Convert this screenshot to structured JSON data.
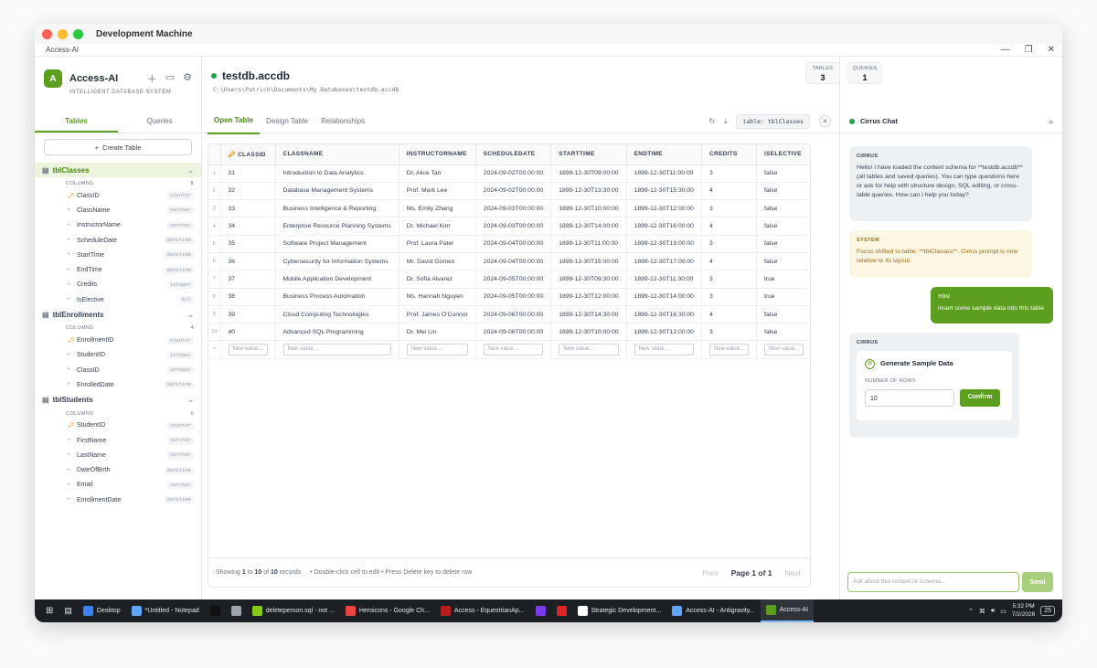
{
  "window": {
    "mac_title": "Development Machine",
    "app_title": "Access-AI"
  },
  "brand": {
    "logo_letter": "A",
    "name": "Access-AI",
    "subtitle": "INTELLIGENT DATABASE SYSTEM"
  },
  "sidebar": {
    "tabs": [
      "Tables",
      "Queries"
    ],
    "create_label": "Create Table",
    "columns_label": "COLUMNS",
    "tables": [
      {
        "name": "tblClasses",
        "count": "8",
        "columns": [
          {
            "name": "ClassID",
            "type": "counter",
            "key": true
          },
          {
            "name": "ClassName",
            "type": "varchar"
          },
          {
            "name": "InstructorName",
            "type": "varchar"
          },
          {
            "name": "ScheduleDate",
            "type": "datetime"
          },
          {
            "name": "StartTime",
            "type": "datetime"
          },
          {
            "name": "EndTime",
            "type": "datetime"
          },
          {
            "name": "Credits",
            "type": "integer"
          },
          {
            "name": "IsElective",
            "type": "bit"
          }
        ]
      },
      {
        "name": "tblEnrollments",
        "count": "4",
        "columns": [
          {
            "name": "EnrollmentID",
            "type": "counter",
            "key": true
          },
          {
            "name": "StudentID",
            "type": "integer"
          },
          {
            "name": "ClassID",
            "type": "integer"
          },
          {
            "name": "EnrolledDate",
            "type": "datetime"
          }
        ]
      },
      {
        "name": "tblStudents",
        "count": "6",
        "columns": [
          {
            "name": "StudentID",
            "type": "counter",
            "key": true
          },
          {
            "name": "FirstName",
            "type": "varchar"
          },
          {
            "name": "LastName",
            "type": "varchar"
          },
          {
            "name": "DateOfBirth",
            "type": "datetime"
          },
          {
            "name": "Email",
            "type": "varchar"
          },
          {
            "name": "EnrollmentDate",
            "type": "datetime"
          }
        ]
      }
    ]
  },
  "header": {
    "db_name": "testdb.accdb",
    "db_path": "C:\\Users\\Patrick\\Documents\\My Databases\\testdb.accdb",
    "stats": [
      {
        "label": "TABLES",
        "value": "3"
      },
      {
        "label": "QUERIES",
        "value": "1"
      }
    ]
  },
  "main": {
    "tabs": [
      "Open Table",
      "Design Table",
      "Relationships"
    ],
    "table_chip": "table: tblClasses",
    "grid": {
      "headers": [
        "CLASSID",
        "CLASSNAME",
        "INSTRUCTORNAME",
        "SCHEDULEDATE",
        "STARTTIME",
        "ENDTIME",
        "CREDITS",
        "ISELECTIVE"
      ],
      "rows": [
        [
          "31",
          "Introduction to Data Analytics",
          "Dr. Alice Tan",
          "2024-09-02T00:00:00",
          "1899-12-30T09:00:00",
          "1899-12-30T11:00:00",
          "3",
          "false"
        ],
        [
          "32",
          "Database Management Systems",
          "Prof. Mark Lee",
          "2024-09-02T00:00:00",
          "1899-12-30T13:30:00",
          "1899-12-30T15:30:00",
          "4",
          "false"
        ],
        [
          "33",
          "Business Intelligence & Reporting",
          "Ms. Emily Zhang",
          "2024-09-03T00:00:00",
          "1899-12-30T10:00:00",
          "1899-12-30T12:00:00",
          "3",
          "false"
        ],
        [
          "34",
          "Enterprise Resource Planning Systems",
          "Dr. Michael Kim",
          "2024-09-03T00:00:00",
          "1899-12-30T14:00:00",
          "1899-12-30T16:00:00",
          "4",
          "false"
        ],
        [
          "35",
          "Software Project Management",
          "Prof. Laura Patel",
          "2024-09-04T00:00:00",
          "1899-12-30T11:00:00",
          "1899-12-30T13:00:00",
          "3",
          "false"
        ],
        [
          "36",
          "Cybersecurity for Information Systems",
          "Mr. David Gomez",
          "2024-09-04T00:00:00",
          "1899-12-30T15:00:00",
          "1899-12-30T17:00:00",
          "4",
          "false"
        ],
        [
          "37",
          "Mobile Application Development",
          "Dr. Sofia Alvarez",
          "2024-09-05T00:00:00",
          "1899-12-30T09:30:00",
          "1899-12-30T11:30:00",
          "3",
          "true"
        ],
        [
          "38",
          "Business Process Automation",
          "Ms. Hannah Nguyen",
          "2024-09-05T00:00:00",
          "1899-12-30T12:00:00",
          "1899-12-30T14:00:00",
          "3",
          "true"
        ],
        [
          "39",
          "Cloud Computing Technologies",
          "Prof. James O'Connor",
          "2024-09-06T00:00:00",
          "1899-12-30T14:30:00",
          "1899-12-30T16:30:00",
          "4",
          "false"
        ],
        [
          "40",
          "Advanced SQL Programming",
          "Dr. Mei Lin",
          "2024-09-06T00:00:00",
          "1899-12-30T10:00:00",
          "1899-12-30T12:00:00",
          "3",
          "false"
        ]
      ],
      "new_row_placeholder": "New value..."
    },
    "footer": {
      "showing": "Showing",
      "from": "1",
      "to_word": "to",
      "to": "10",
      "of_word": "of",
      "total": "10",
      "records": "records",
      "hint": "• Double-click cell to edit • Press Delete key to delete row",
      "prev": "Prev",
      "page": "Page 1 of 1",
      "next": "Next"
    }
  },
  "chat": {
    "title": "Cirrus Chat",
    "messages": {
      "cirrus_who": "CIRRUS",
      "cirrus_text": "Hello! I have loaded the context schema for **testdb.accdb** (all tables and saved queries). You can type questions here or ask for help with structure design, SQL editing, or cross-table queries. How can I help you today?",
      "system_who": "SYSTEM",
      "system_text": "Focus shifted to table: **tblClasses**. Cirrus prompt is now relative to its layout.",
      "user_who": "YOU",
      "user_text": "insert some sample data into this table",
      "gen_who": "CIRRUS",
      "gen_title": "Generate Sample Data",
      "gen_label": "NUMBER OF ROWS",
      "gen_value": "10",
      "gen_confirm": "Confirm"
    },
    "input_placeholder": "Ask about this context or schema...",
    "send_label": "Send"
  },
  "taskbar": {
    "items": [
      {
        "label": "Desktop",
        "color": "#3b82f6"
      },
      {
        "label": "*Untitled - Notepad",
        "color": "#60a5fa"
      },
      {
        "label": "",
        "color": "#111111"
      },
      {
        "label": "",
        "color": "#9ca3af"
      },
      {
        "label": "deleteperson.sql - not ...",
        "color": "#84cc16"
      },
      {
        "label": "Heroicons - Google Ch...",
        "color": "#ef4444"
      },
      {
        "label": "Access - EquestrianAp...",
        "color": "#b91c1c"
      },
      {
        "label": "",
        "color": "#7c3aed"
      },
      {
        "label": "",
        "color": "#dc2626"
      },
      {
        "label": "Strategic Development...",
        "color": "#ffffff"
      },
      {
        "label": "Access-AI - Antigravity...",
        "color": "#60a5fa"
      },
      {
        "label": "Access-AI",
        "color": "#5c9e1e",
        "active": true
      }
    ],
    "time": "5:32 PM",
    "date": "7/2/2026",
    "badge": "25"
  },
  "colors": {
    "accent": "#5c9e1e",
    "accent_light": "#ecf4dd",
    "system_bg": "#fdf6e3"
  }
}
